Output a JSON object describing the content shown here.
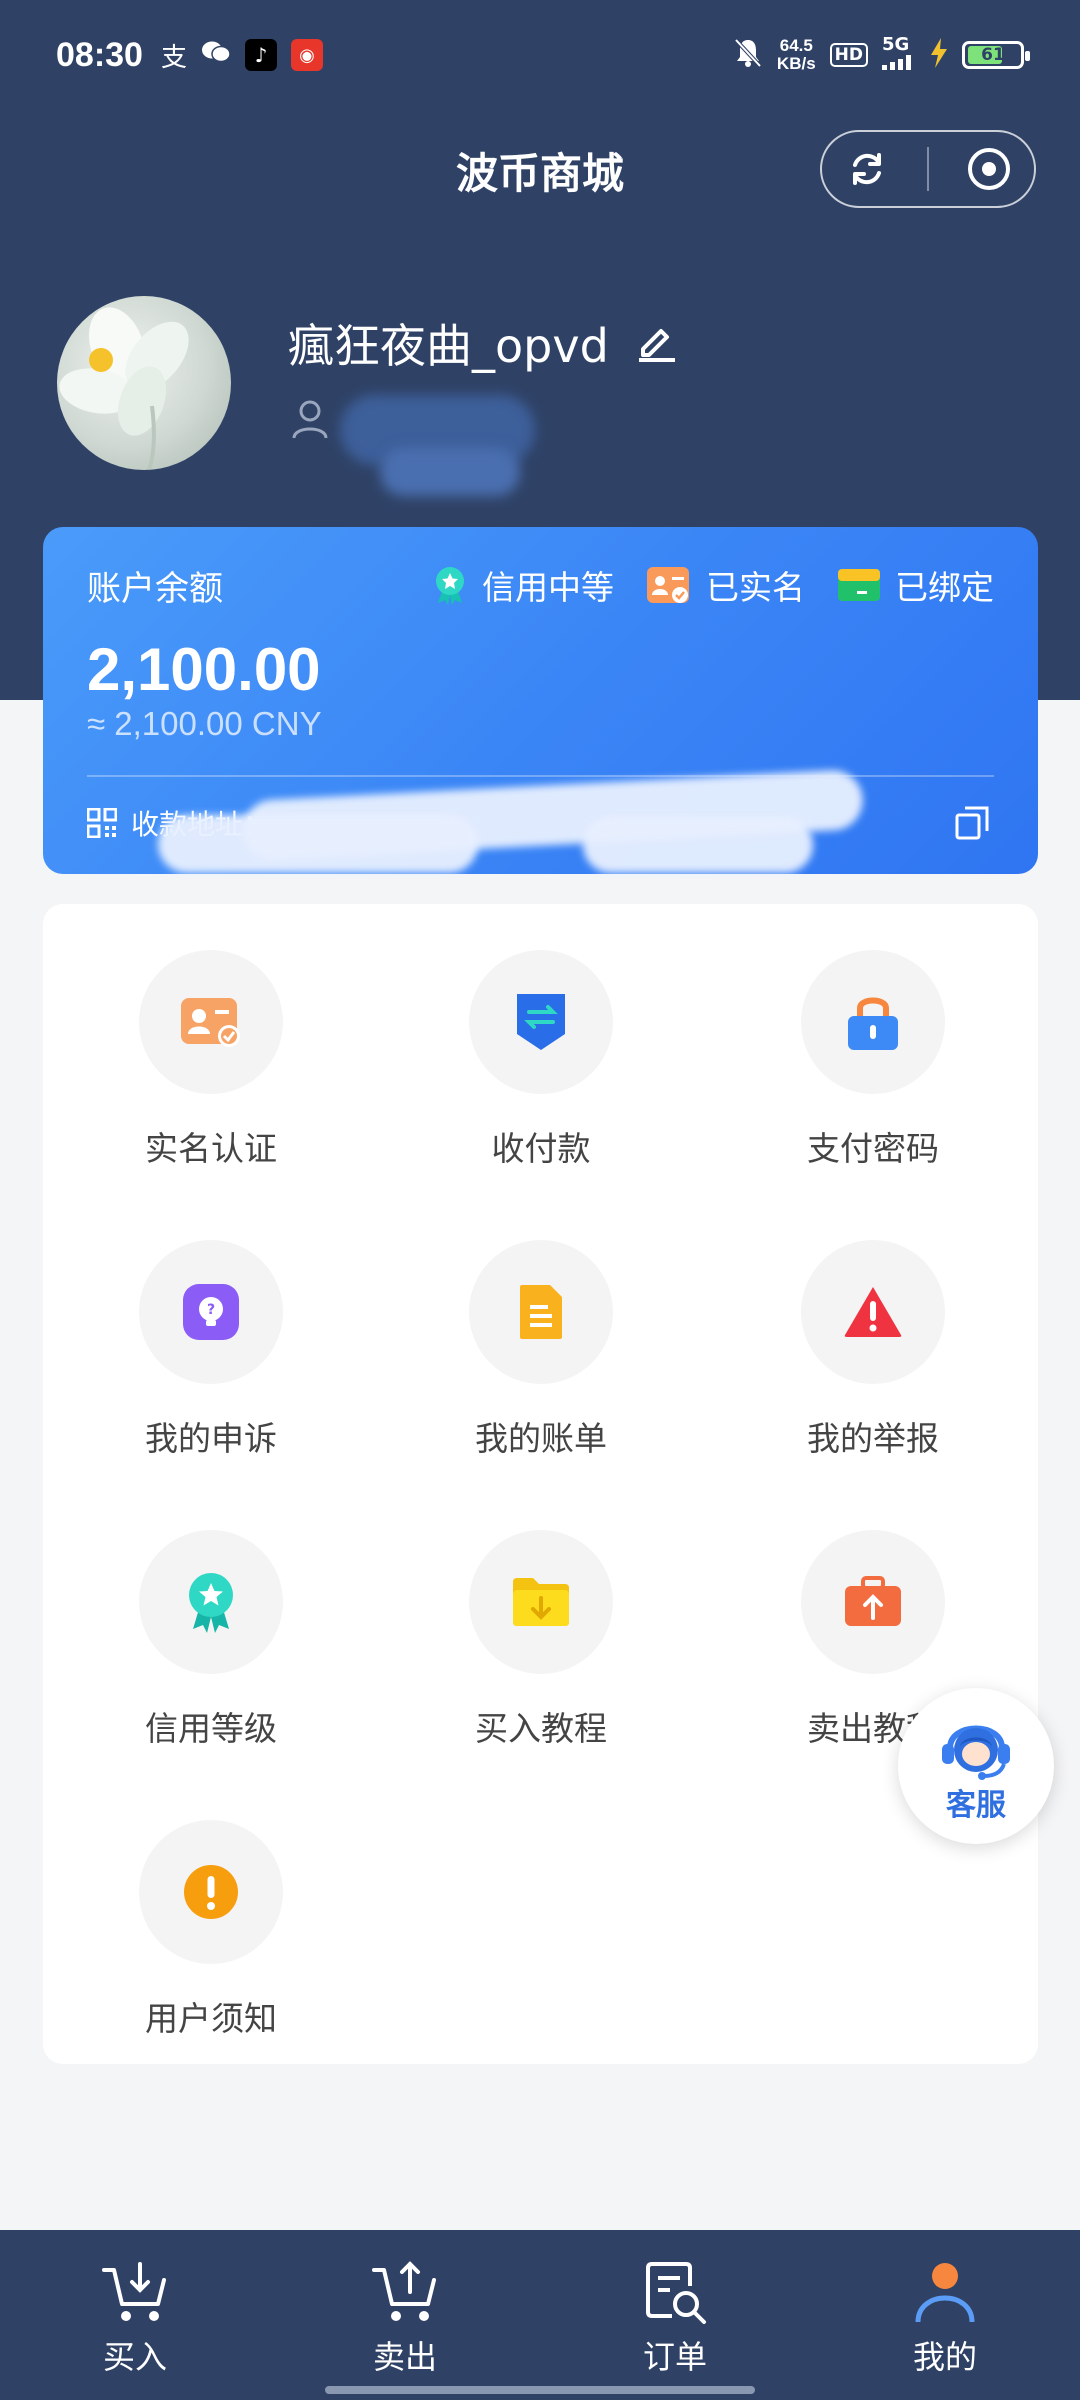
{
  "status_bar": {
    "time": "08:30",
    "net_speed_value": "64.5",
    "net_speed_unit": "KB/s",
    "hd": "HD",
    "network": "5G",
    "battery": "61",
    "apps": [
      "alipay-icon",
      "wechat-icon",
      "tiktok-icon",
      "red-app-icon"
    ]
  },
  "header": {
    "title": "波币商城"
  },
  "profile": {
    "username": "瘋狂夜曲_opvd"
  },
  "balance_card": {
    "label": "账户余额",
    "value": "2,100.00",
    "cny": "≈ 2,100.00 CNY",
    "badges": [
      {
        "label": "信用中等",
        "icon": "medal-icon"
      },
      {
        "label": "已实名",
        "icon": "id-card-icon"
      },
      {
        "label": "已绑定",
        "icon": "bank-card-icon"
      }
    ],
    "address_label": "收款地址："
  },
  "grid": [
    {
      "label": "实名认证",
      "icon": "id-verify-icon"
    },
    {
      "label": "收付款",
      "icon": "transfer-icon"
    },
    {
      "label": "支付密码",
      "icon": "lock-icon"
    },
    {
      "label": "我的申诉",
      "icon": "appeal-icon"
    },
    {
      "label": "我的账单",
      "icon": "bill-icon"
    },
    {
      "label": "我的举报",
      "icon": "warning-icon"
    },
    {
      "label": "信用等级",
      "icon": "credit-medal-icon"
    },
    {
      "label": "买入教程",
      "icon": "buy-guide-icon"
    },
    {
      "label": "卖出教程",
      "icon": "sell-guide-icon"
    },
    {
      "label": "用户须知",
      "icon": "notice-icon"
    }
  ],
  "customer_service": {
    "label": "客服"
  },
  "bottom_nav": [
    {
      "label": "买入",
      "icon": "cart-download-icon"
    },
    {
      "label": "卖出",
      "icon": "cart-upload-icon"
    },
    {
      "label": "订单",
      "icon": "order-search-icon"
    },
    {
      "label": "我的",
      "icon": "user-icon",
      "active": true
    }
  ],
  "colors": {
    "header_bg": "#2f4266",
    "card_blue": "#3b86f6",
    "accent_orange": "#f7873e"
  }
}
